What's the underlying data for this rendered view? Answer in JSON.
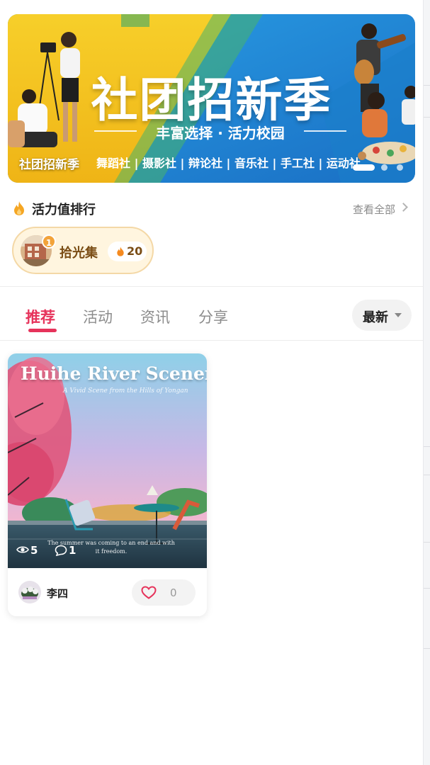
{
  "banner": {
    "title": "社团招新季",
    "subtitle": "丰富选择 · 活力校园",
    "clubs": "舞蹈社 | 摄影社 | 辩论社 | 音乐社 | 手工社 | 运动社",
    "corner_label": "社团招新季",
    "slide_count": 3,
    "active_slide": 1
  },
  "ranking": {
    "title": "活力值排行",
    "see_all": "查看全部",
    "items": [
      {
        "rank": "1",
        "name": "拾光集",
        "score": "20"
      }
    ]
  },
  "tabs": {
    "items": [
      {
        "label": "推荐",
        "active": true
      },
      {
        "label": "活动",
        "active": false
      },
      {
        "label": "资讯",
        "active": false
      },
      {
        "label": "分享",
        "active": false
      }
    ],
    "sort_label": "最新"
  },
  "posts": [
    {
      "cover_title": "Huihe River Scenery",
      "cover_subtitle": "A Vivid Scene from the Hills of Yongan",
      "cover_caption": "The summer was coming to an end and with it freedom.",
      "views": "5",
      "comments": "1",
      "author": "李四",
      "likes": "0"
    }
  ],
  "colors": {
    "accent": "#e6335b",
    "rank_chip_bg": "#fff5df",
    "rank_text": "#7a4d15",
    "banner_blue": "#1f8fd9",
    "banner_yellow": "#f4c21f"
  }
}
